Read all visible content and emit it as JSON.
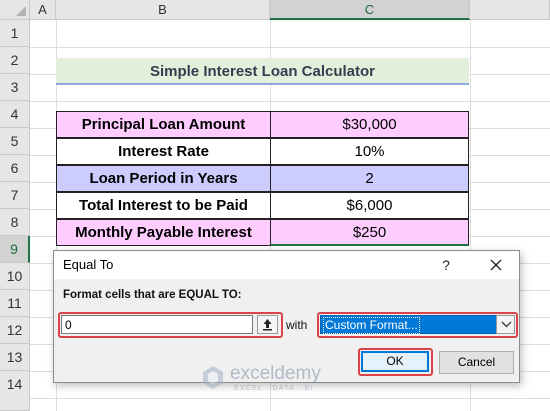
{
  "sheet": {
    "columns": [
      "A",
      "B",
      "C"
    ],
    "rows": [
      "1",
      "2",
      "3",
      "4",
      "5",
      "6",
      "7",
      "8",
      "9",
      "10",
      "11",
      "12",
      "13",
      "14"
    ],
    "selected_column": "C",
    "selected_row": "9",
    "title": "Simple Interest Loan Calculator",
    "table": [
      {
        "label": "Principal Loan Amount",
        "value": "$30,000"
      },
      {
        "label": "Interest Rate",
        "value": "10%"
      },
      {
        "label": "Loan Period in Years",
        "value": "2"
      },
      {
        "label": "Total Interest to be Paid",
        "value": "$6,000"
      },
      {
        "label": "Monthly Payable Interest",
        "value": "$250"
      }
    ]
  },
  "dialog": {
    "title": "Equal To",
    "help": "?",
    "prompt": "Format cells that are EQUAL TO:",
    "input_value": "0",
    "with_label": "with",
    "format_selected": "Custom Format...",
    "ok_label": "OK",
    "cancel_label": "Cancel"
  },
  "watermark": {
    "name": "exceldemy",
    "tagline": "EXCEL · DATA · BI"
  },
  "colors": {
    "title_fill": "#e2efda",
    "pink_fill": "#ffccff",
    "lavender_fill": "#ccccff",
    "highlight_red": "#d9434a",
    "selection_blue": "#0078d7",
    "excel_green": "#217346"
  }
}
